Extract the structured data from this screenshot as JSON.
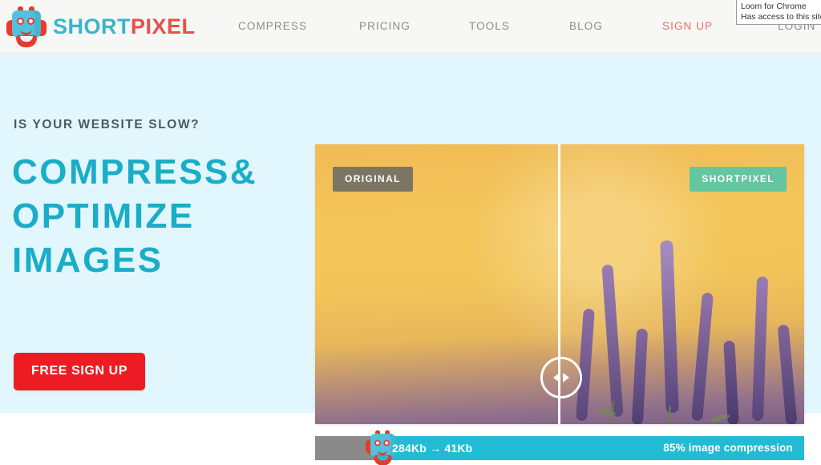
{
  "header": {
    "logo": {
      "icon": "shortpixel-robot-icon",
      "part1": "SHORT",
      "part2": "PIXEL"
    },
    "nav": [
      {
        "id": "compress",
        "label": "COMPRESS"
      },
      {
        "id": "pricing",
        "label": "PRICING"
      },
      {
        "id": "tools",
        "label": "TOOLS"
      },
      {
        "id": "blog",
        "label": "BLOG"
      },
      {
        "id": "signup",
        "label": "SIGN UP"
      },
      {
        "id": "login",
        "label": "LOGIN"
      }
    ],
    "extension_tooltip": {
      "line1": "Loom for Chrome",
      "line2": "Has access to this site"
    }
  },
  "hero": {
    "tagline": "IS YOUR WEBSITE SLOW?",
    "headline_line1": "COMPRESS&",
    "headline_line2": "OPTIMIZE",
    "headline_line3": "IMAGES",
    "cta_label": "FREE SIGN UP"
  },
  "comparison": {
    "label_left": "ORIGINAL",
    "label_right": "SHORTPIXEL",
    "slider_icon": "left-right-arrows-icon",
    "stats": {
      "size_before": "284Kb",
      "arrow": "→",
      "size_after": "41Kb",
      "sizes_combined": "284Kb → 41Kb",
      "compression": "85% image compression",
      "mascot_icon": "shortpixel-robot-icon"
    }
  },
  "colors": {
    "brand_teal": "#1aadc8",
    "brand_red": "#e8504a",
    "cta_red": "#ed1c24",
    "hero_bg": "#e2f6fd",
    "header_bg": "#f7f7f5",
    "stats_bar": "#21bcd4",
    "stats_gray": "#8a8a8a",
    "label_original": "#7d7563",
    "label_shortpixel": "#63c6a0",
    "nav_text": "#8c8c8c",
    "signup_text": "#ef6e6a",
    "tagline_text": "#4a5a63"
  }
}
